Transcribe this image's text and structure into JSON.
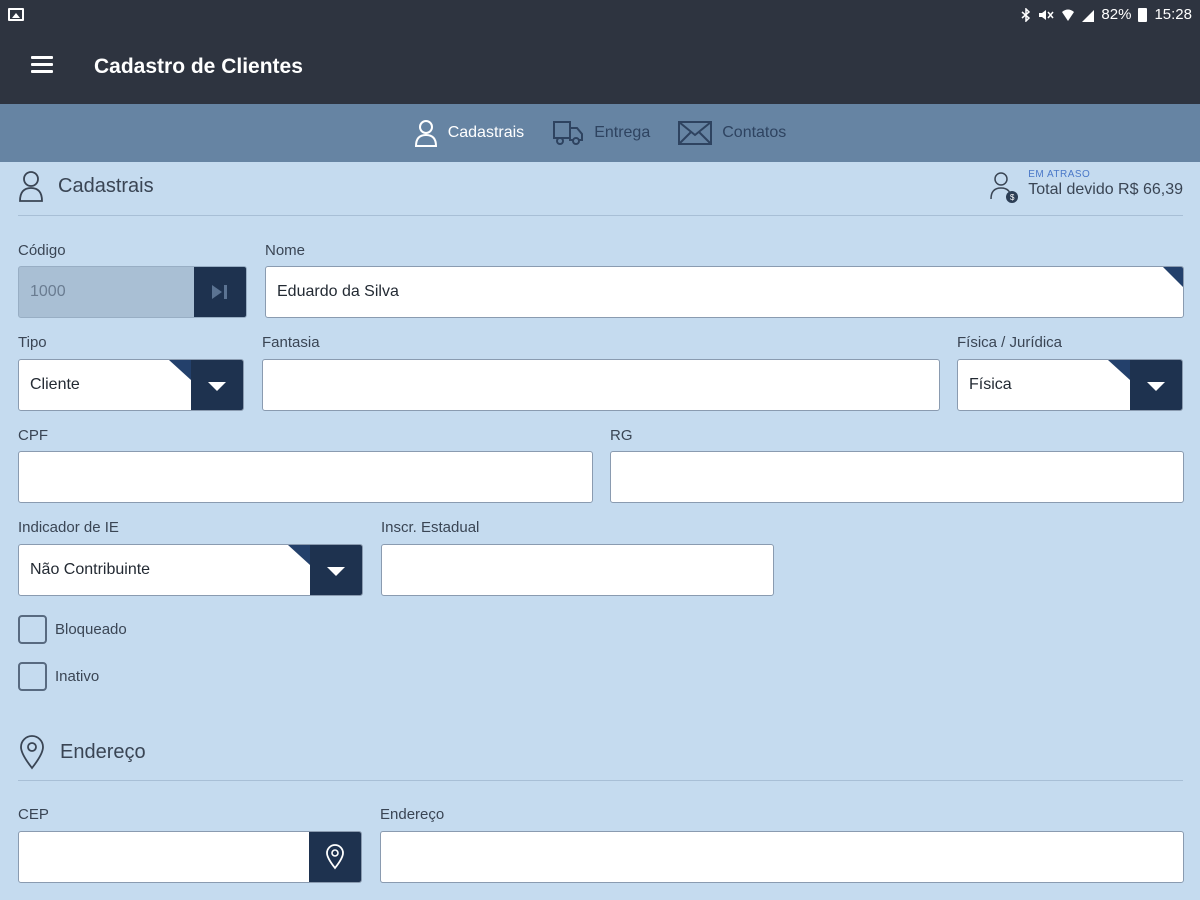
{
  "status_bar": {
    "battery_percent": "82%",
    "time": "15:28"
  },
  "app_bar": {
    "title": "Cadastro de Clientes",
    "menu_icon": "hamburger-icon"
  },
  "tabs": [
    {
      "label": "Cadastrais",
      "icon": "person-icon",
      "active": true
    },
    {
      "label": "Entrega",
      "icon": "truck-icon",
      "active": false
    },
    {
      "label": "Contatos",
      "icon": "envelope-icon",
      "active": false
    }
  ],
  "cadastrais": {
    "section_title": "Cadastrais",
    "overdue": {
      "status": "EM ATRASO",
      "total": "Total devido R$ 66,39",
      "badge": "$"
    },
    "codigo": {
      "label": "Código",
      "value": "1000"
    },
    "nome": {
      "label": "Nome",
      "value": "Eduardo da Silva"
    },
    "tipo": {
      "label": "Tipo",
      "value": "Cliente"
    },
    "fantasia": {
      "label": "Fantasia",
      "value": ""
    },
    "fisica_juridica": {
      "label": "Física / Jurídica",
      "value": "Física"
    },
    "cpf": {
      "label": "CPF",
      "value": ""
    },
    "rg": {
      "label": "RG",
      "value": ""
    },
    "indicador_ie": {
      "label": "Indicador de IE",
      "value": "Não Contribuinte"
    },
    "inscr_estadual": {
      "label": "Inscr. Estadual",
      "value": ""
    },
    "bloqueado": {
      "label": "Bloqueado"
    },
    "inativo": {
      "label": "Inativo"
    }
  },
  "endereco": {
    "section_title": "Endereço",
    "cep": {
      "label": "CEP",
      "value": ""
    },
    "endereco": {
      "label": "Endereço",
      "value": ""
    }
  },
  "colors": {
    "app_bar": "#2e3440",
    "tab_bar": "#6684a3",
    "background": "#c5dbef",
    "button": "#1e324f"
  }
}
